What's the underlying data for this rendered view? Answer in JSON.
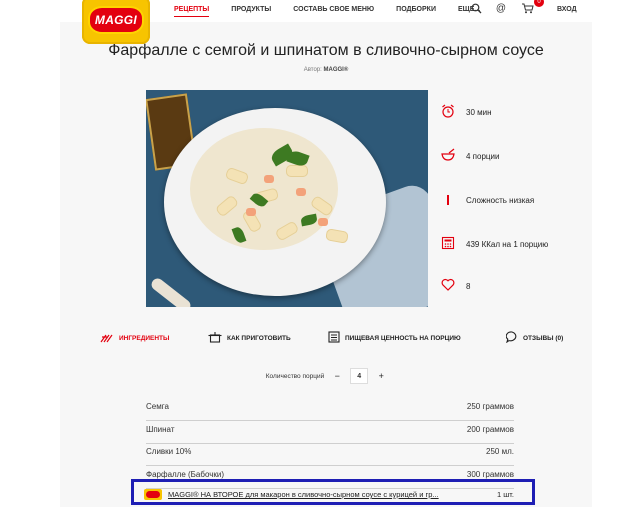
{
  "header": {
    "logo_text": "MAGGI",
    "nav": [
      "РЕЦЕПТЫ",
      "ПРОДУКТЫ",
      "СОСТАВЬ СВОЕ МЕНЮ",
      "ПОДБОРКИ",
      "ЕЩЕ..."
    ],
    "cart_count": "0",
    "login_label": "ВХОД",
    "icons": [
      "search-icon",
      "at-icon",
      "cart-icon"
    ]
  },
  "recipe": {
    "title": "Фарфалле с семгой и шпинатом в сливочно-сырном соусе",
    "author_label": "Автор:",
    "author_name": "MAGGI®"
  },
  "stats": [
    {
      "icon": "alarm-clock-icon",
      "text": "30 мин"
    },
    {
      "icon": "bowl-icon",
      "text": "4 порции"
    },
    {
      "icon": "difficulty-icon",
      "text": "Сложность низкая"
    },
    {
      "icon": "calculator-icon",
      "text": "439 ККал на 1 порцию"
    },
    {
      "icon": "heart-icon",
      "text": "8"
    }
  ],
  "tabs": [
    {
      "label": "ИНГРЕДИЕНТЫ",
      "icon": "ingredients-icon",
      "active": true
    },
    {
      "label": "КАК ПРИГОТОВИТЬ",
      "icon": "pot-icon",
      "active": false
    },
    {
      "label": "ПИЩЕВАЯ ЦЕННОСТЬ НА ПОРЦИЮ",
      "icon": "nutrition-icon",
      "active": false
    },
    {
      "label": "ОТЗЫВЫ (0)",
      "icon": "comment-icon",
      "active": false
    }
  ],
  "portions": {
    "label": "Количество порций",
    "minus": "−",
    "value": "4",
    "plus": "+"
  },
  "ingredients": [
    {
      "name": "Семга",
      "qty": "250 граммов"
    },
    {
      "name": "Шпинат",
      "qty": "200 граммов"
    },
    {
      "name": "Сливки 10%",
      "qty": "250 мл."
    },
    {
      "name": "Фарфалле (Бабочки)",
      "qty": "300 граммов"
    }
  ],
  "product_row": {
    "link": "MAGGI® НА ВТОРОЕ для макарон в сливочно-сырном соусе с курицей и гр...",
    "qty": "1 шт."
  },
  "colors": {
    "accent": "#e3000f",
    "brand_yellow": "#f7c400",
    "highlight_border": "#1e1eb4"
  }
}
